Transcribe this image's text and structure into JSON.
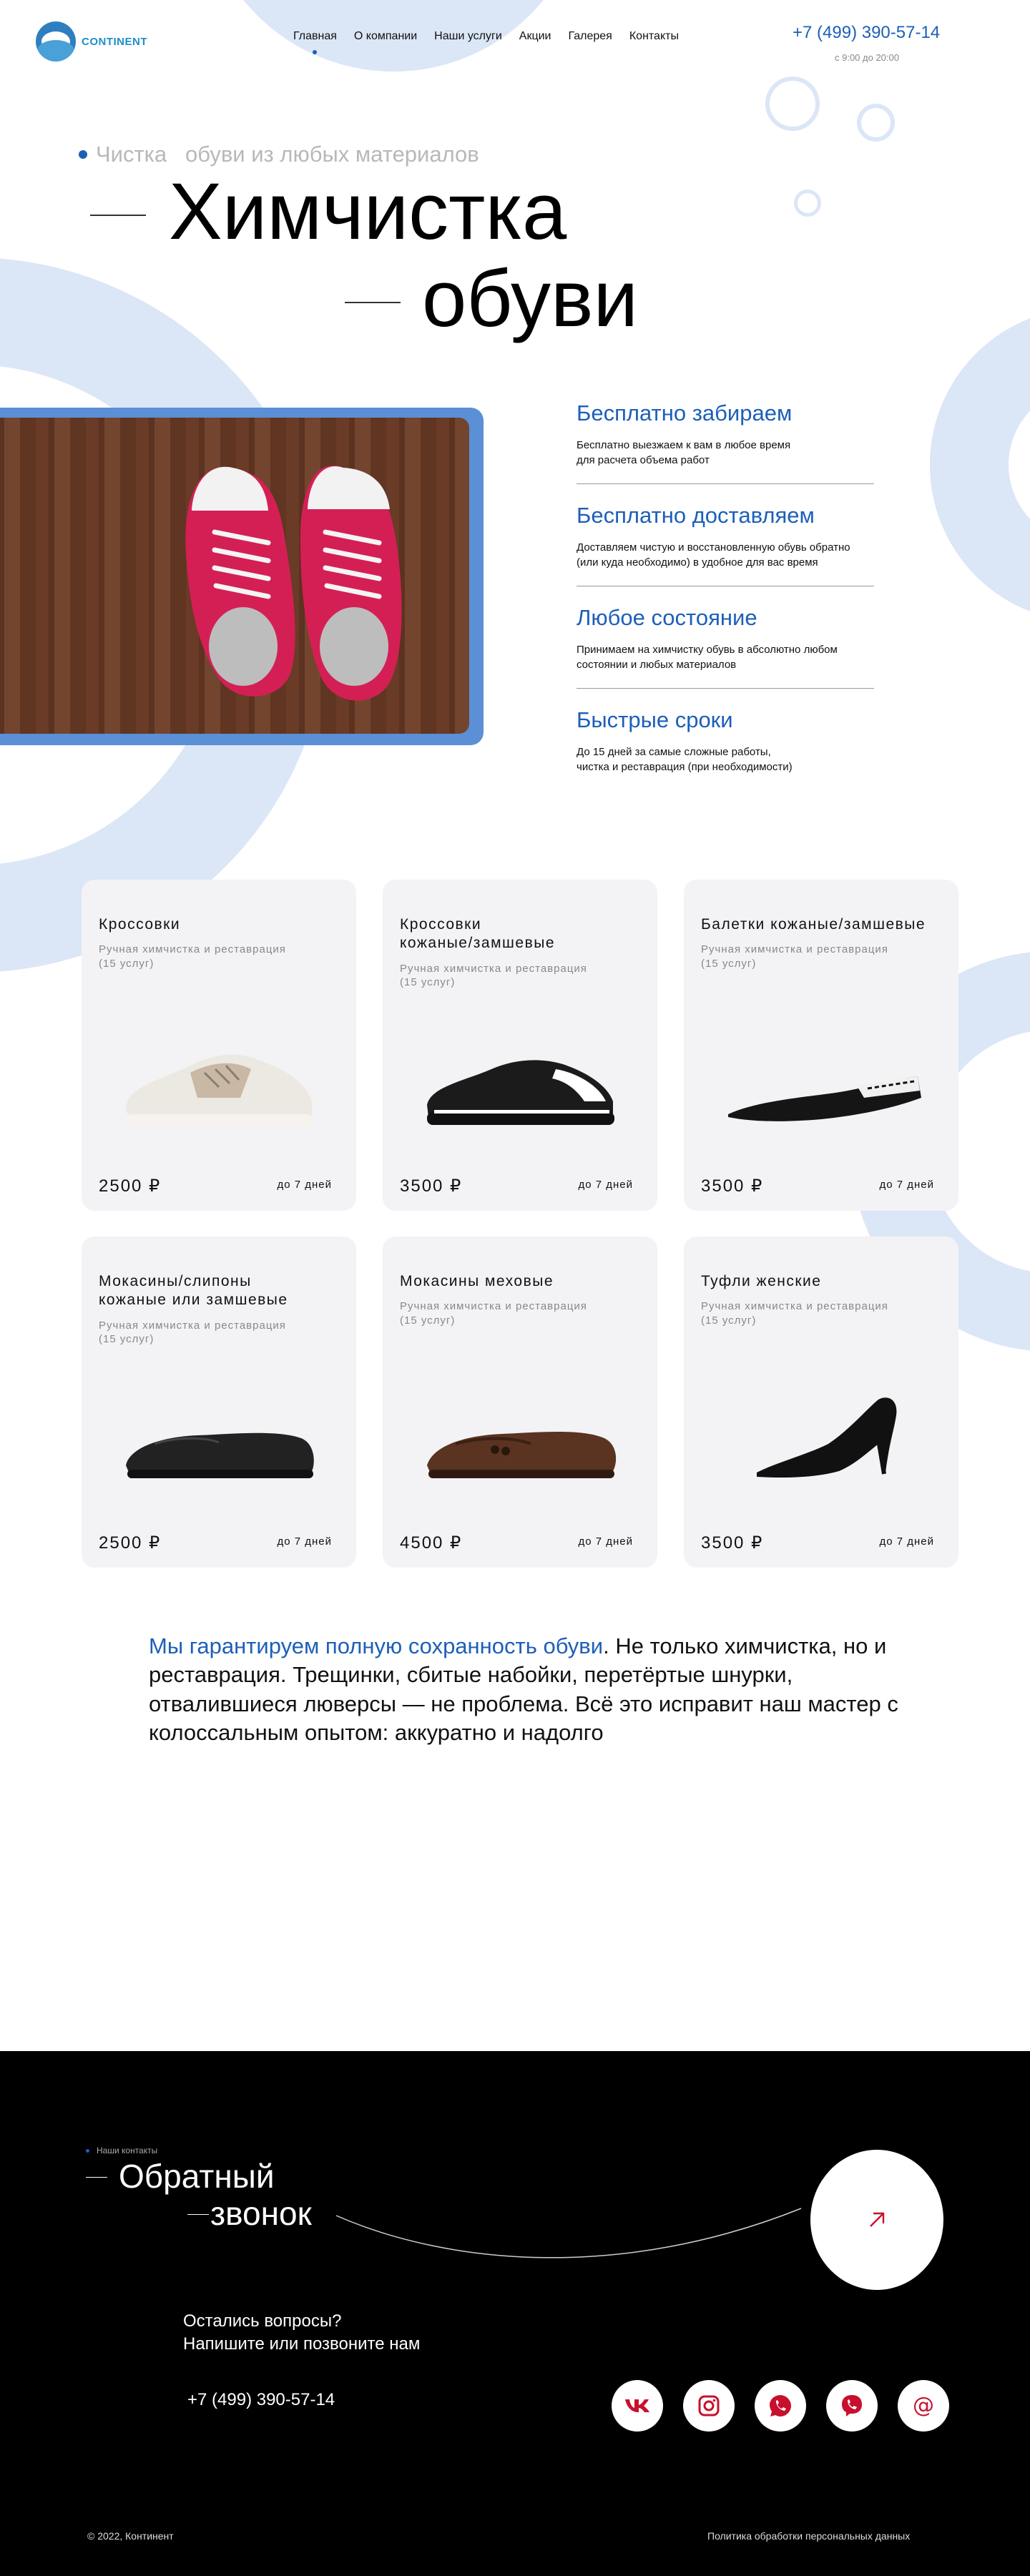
{
  "header": {
    "logo_text": "CONTINENT",
    "nav": [
      {
        "label": "Главная",
        "active": true
      },
      {
        "label": "О компании",
        "active": false
      },
      {
        "label": "Наши услуги",
        "active": false
      },
      {
        "label": "Акции",
        "active": false
      },
      {
        "label": "Галерея",
        "active": false
      },
      {
        "label": "Контакты",
        "active": false
      }
    ],
    "phone": "+7 (499) 390-57-14",
    "hours": "с 9:00 до 20:00"
  },
  "hero": {
    "eyebrow": "Чистка   обуви из любых материалов",
    "title_line1": "Химчистка",
    "title_line2": "обуви"
  },
  "features": [
    {
      "title": "Бесплатно забираем",
      "text": "Бесплатно выезжаем к вам в любое время\nдля расчета объема работ"
    },
    {
      "title": "Бесплатно доставляем",
      "text": " Доставляем чистую и восстановленную обувь обратно\n(или куда необходимо) в удобное для вас время"
    },
    {
      "title": "Любое состояние",
      "text": "Принимаем на химчистку обувь в абсолютно любом\nсостоянии и любых материалов"
    },
    {
      "title": "Быстрые сроки",
      "text": " До 15 дней за самые сложные работы,\nчистка и реставрация (при необходимости)"
    }
  ],
  "products": [
    {
      "name": "Кроссовки",
      "sub": "Ручная химчистка и реставрация\n(15 услуг)",
      "price": "2500 ₽",
      "term": "до 7 дней",
      "icon": "sneaker-white-icon"
    },
    {
      "name": "Кроссовки\nкожаные/замшевые",
      "sub": "Ручная химчистка и реставрация\n(15 услуг)",
      "price": "3500 ₽",
      "term": "до 7 дней",
      "icon": "sneaker-black-icon"
    },
    {
      "name": "Балетки кожаные/замшевые",
      "sub": "Ручная химчистка и реставрация\n(15 услуг)",
      "price": "3500 ₽",
      "term": "до 7 дней",
      "icon": "ballet-flat-icon"
    },
    {
      "name": "Мокасины/слипоны\nкожаные или замшевые",
      "sub": "Ручная химчистка и реставрация\n(15 услуг)",
      "price": "2500 ₽",
      "term": "до 7 дней",
      "icon": "moccasin-black-icon"
    },
    {
      "name": "Мокасины меховые",
      "sub": "Ручная химчистка и реставрация\n(15 услуг)",
      "price": "4500 ₽",
      "term": "до 7 дней",
      "icon": "moccasin-brown-icon"
    },
    {
      "name": "Туфли женские",
      "sub": "Ручная химчистка и реставрация\n(15 услуг)",
      "price": "3500 ₽",
      "term": "до 7 дней",
      "icon": "heel-pump-icon"
    }
  ],
  "guarantee": {
    "highlight": "Мы гарантируем  полную сохранность обуви",
    "text": ". Не только химчистка, но и реставрация. Трещинки, сбитые набойки, перетёртые шнурки, отвалившиеся люверсы — не проблема. Всё это исправит наш мастер с колоссальным опытом: аккуратно и надолго"
  },
  "footer": {
    "eyebrow": "Наши контакты",
    "title_line1": "Обратный",
    "title_line2": "звонок",
    "question": "Остались вопросы?\nНапишите или позвоните нам",
    "phone": "+7 (499) 390-57-14",
    "socials": [
      "vk-icon",
      "instagram-icon",
      "whatsapp-icon",
      "viber-icon",
      "email-icon"
    ],
    "copyright": "© 2022, Континент",
    "policy": "Политика обработки персональных данных"
  },
  "colors": {
    "accent": "#1d5fb8",
    "deco": "#dbe6f6",
    "footer_bg": "#000000",
    "cta_arrow": "#c8102e",
    "card_bg": "#f3f3f5"
  }
}
